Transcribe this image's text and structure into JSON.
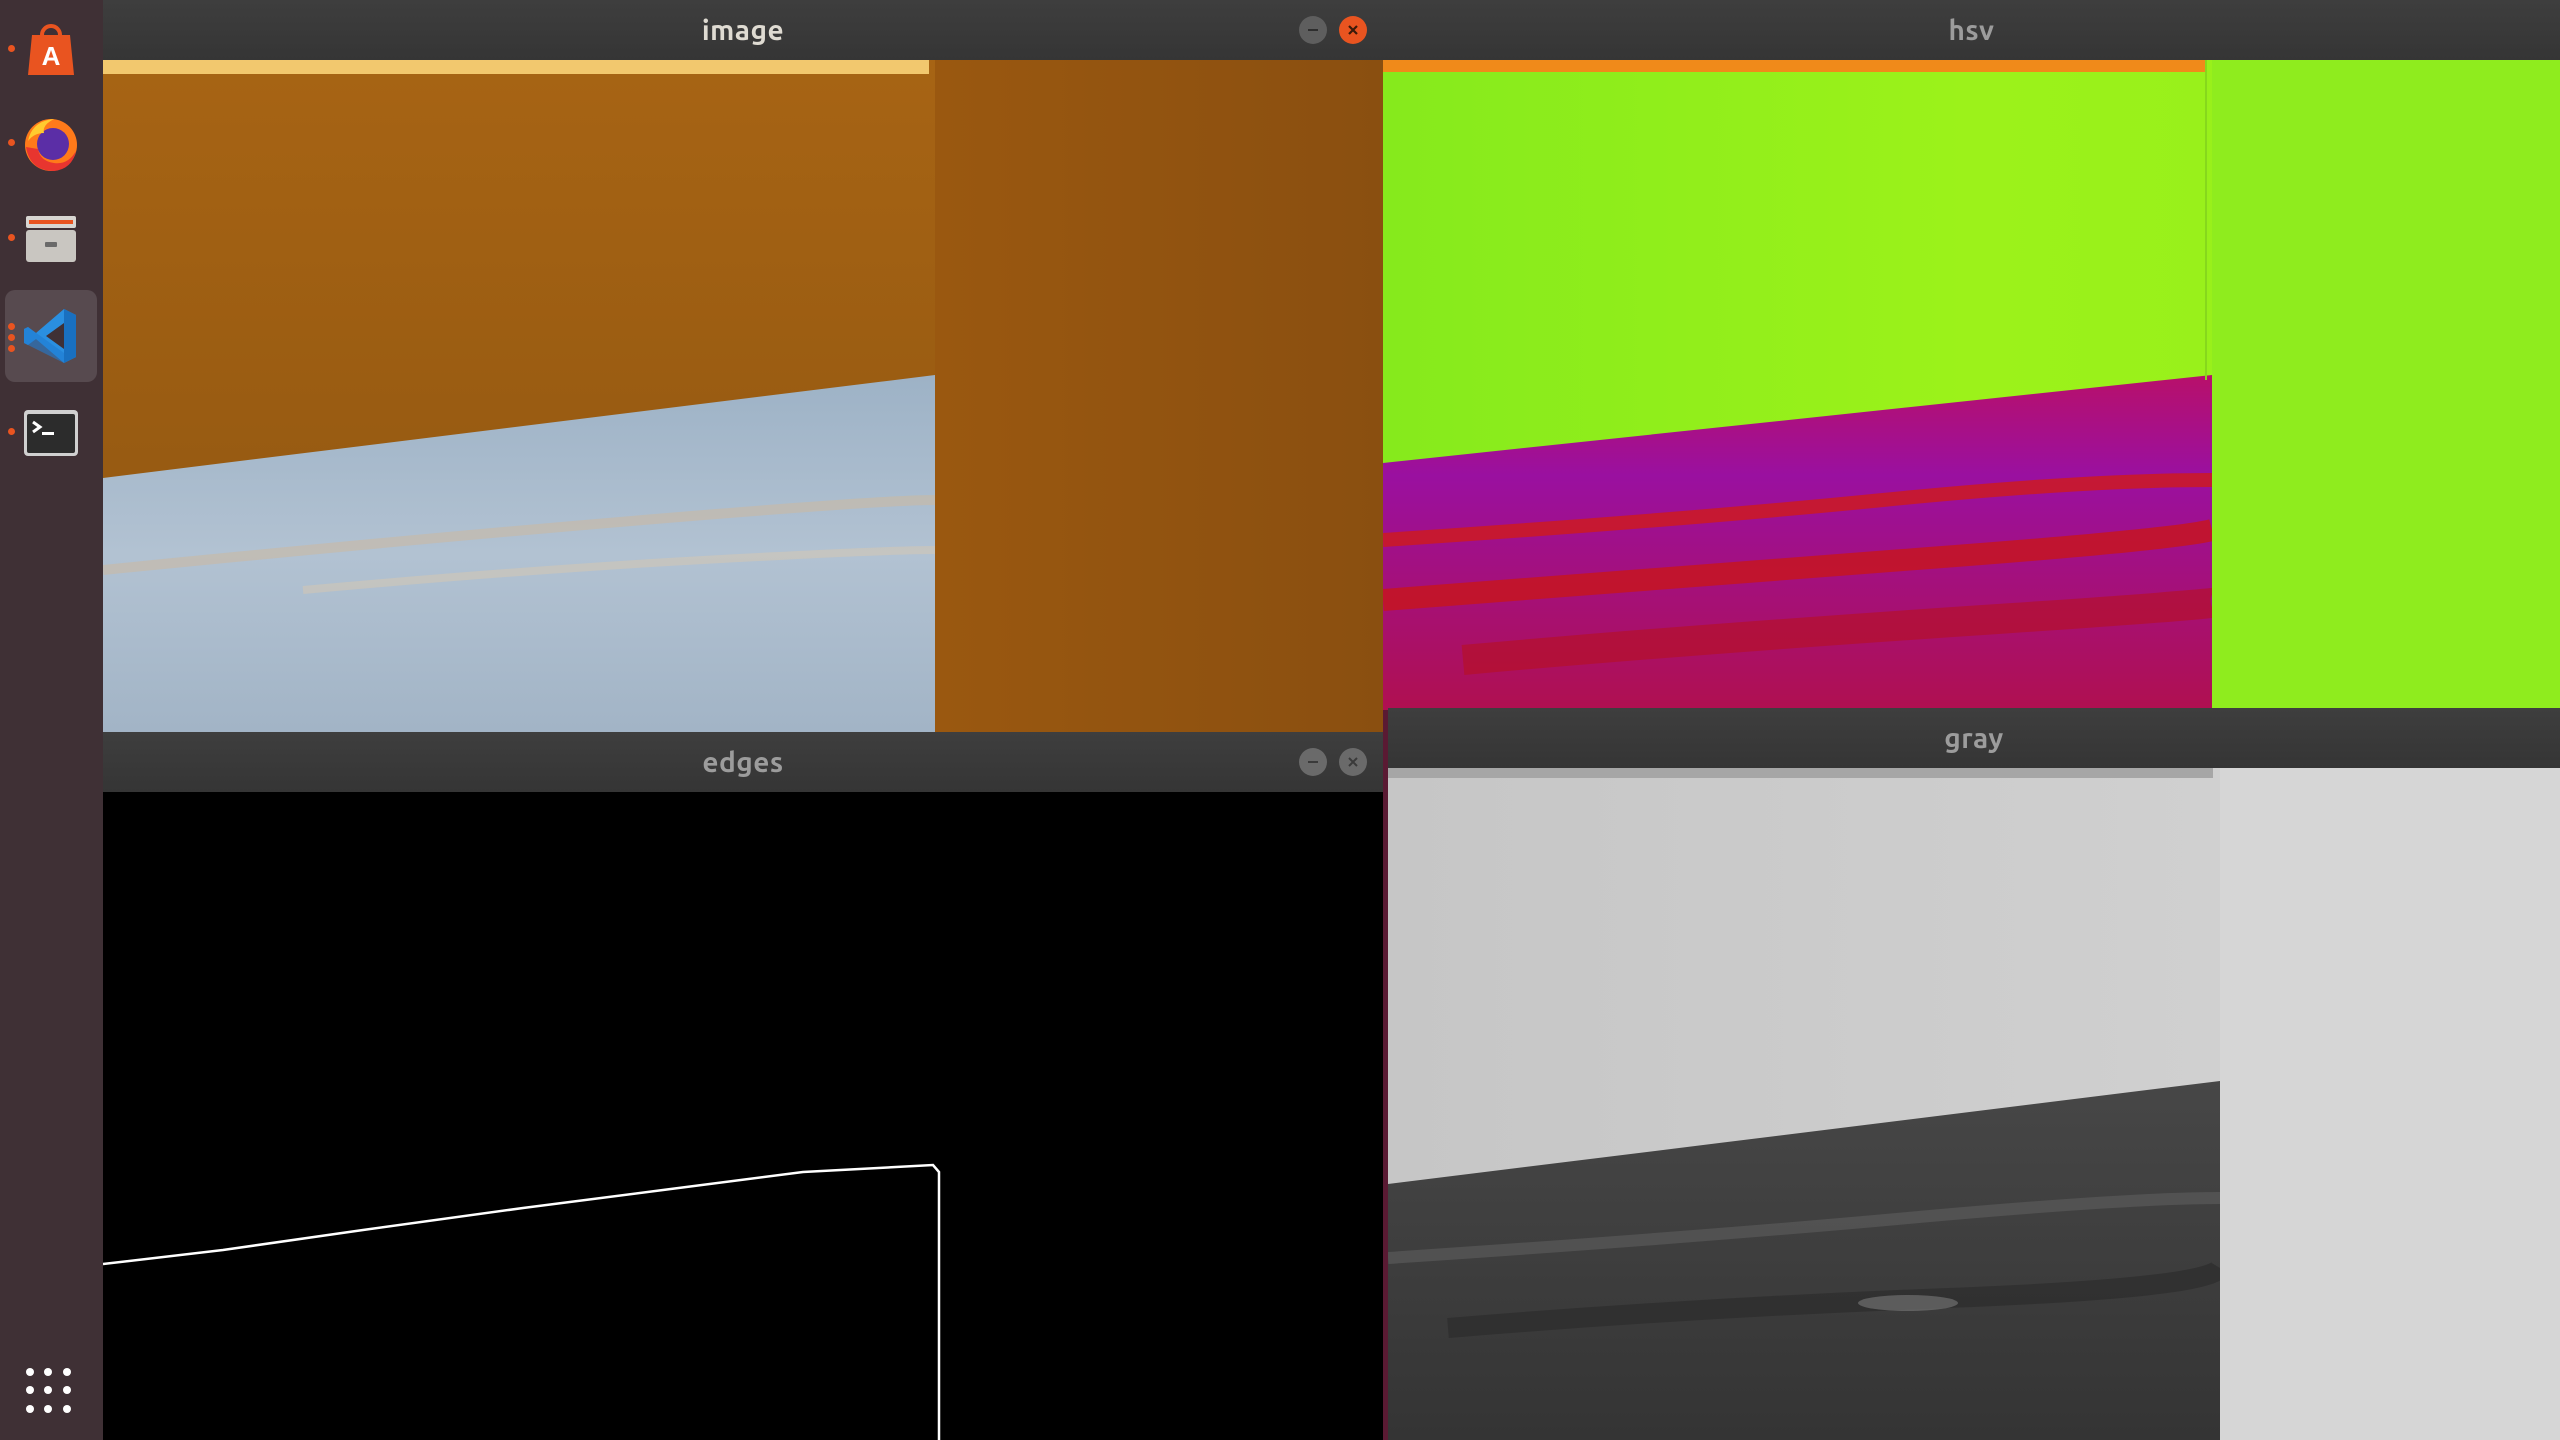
{
  "windows": {
    "image": {
      "title": "image"
    },
    "hsv": {
      "title": "hsv"
    },
    "edges": {
      "title": "edges"
    },
    "gray": {
      "title": "gray"
    }
  },
  "dock": {
    "items": [
      {
        "name": "ubuntu-software-icon",
        "running": true
      },
      {
        "name": "firefox-icon",
        "running": true
      },
      {
        "name": "file-manager-icon",
        "running": true
      },
      {
        "name": "vscode-icon",
        "running": true,
        "active": true
      },
      {
        "name": "terminal-icon",
        "running": true
      }
    ],
    "show_apps": "show-applications-icon"
  },
  "colors": {
    "titlebar": "#3a3a3a",
    "close_active": "#e95420",
    "dock_bg": "#3f3035",
    "desktop": "#5a1a33",
    "image_wall": "#9a5a10",
    "image_floor": "#a8b8c8",
    "hsv_wall": "#8ef01a",
    "hsv_floor": "#b0108a",
    "gray_wall": "#cfcfcf",
    "gray_floor": "#3c3c3c"
  }
}
